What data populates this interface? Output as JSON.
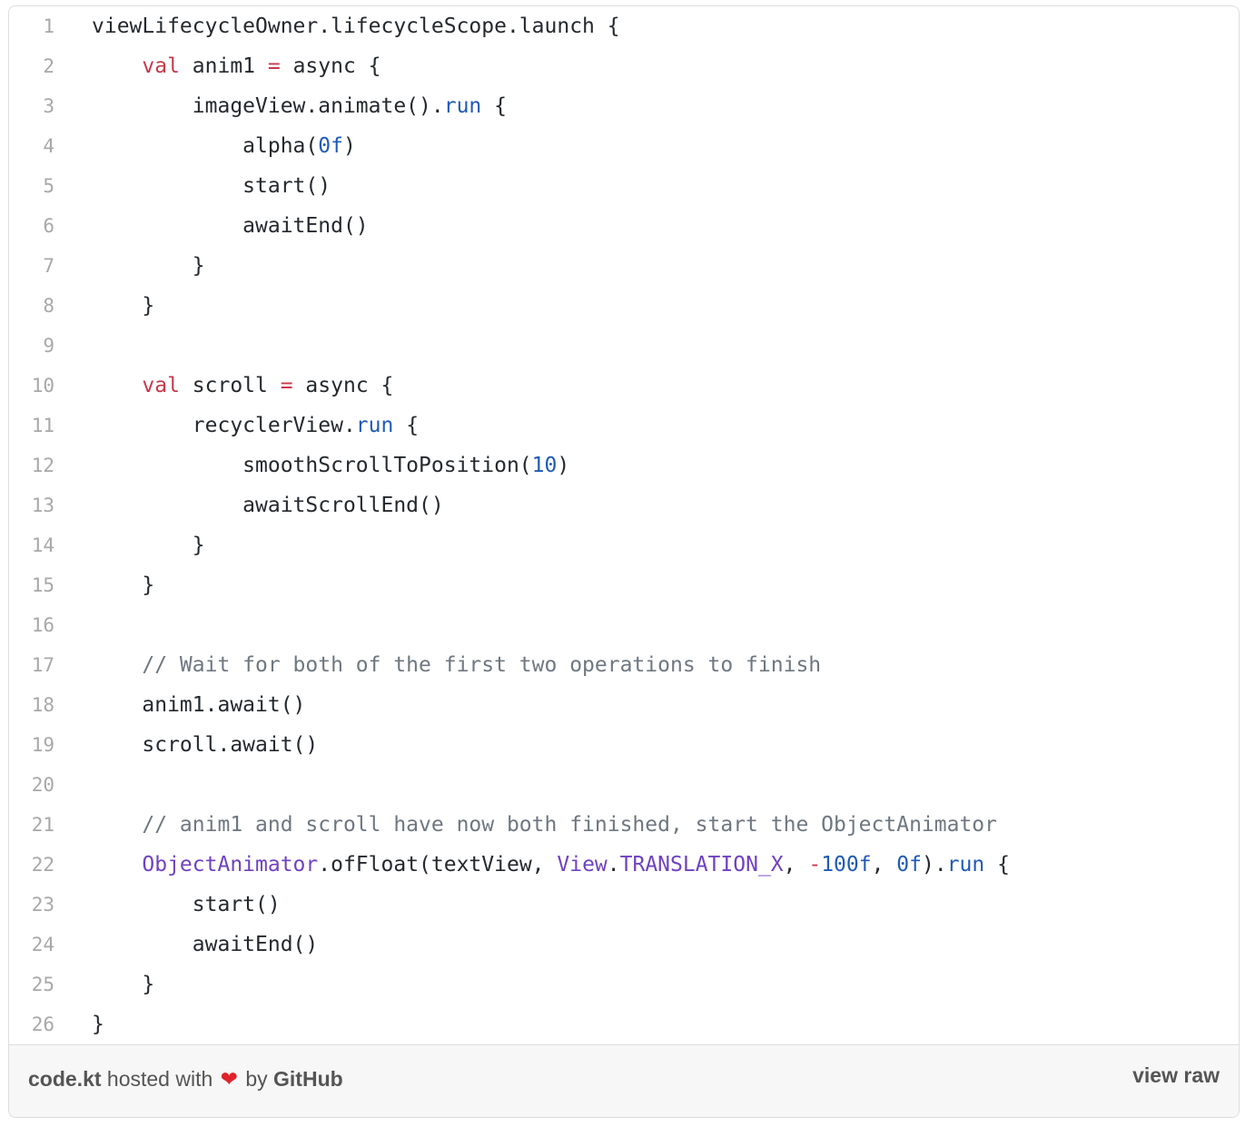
{
  "code": {
    "lines": [
      {
        "n": "1",
        "tokens": [
          {
            "t": "viewLifecycleOwner.lifecycleScope.launch {",
            "c": "fn"
          }
        ]
      },
      {
        "n": "2",
        "tokens": [
          {
            "t": "    ",
            "c": "fn"
          },
          {
            "t": "val",
            "c": "kw"
          },
          {
            "t": " anim1 ",
            "c": "fn"
          },
          {
            "t": "=",
            "c": "kw"
          },
          {
            "t": " async {",
            "c": "fn"
          }
        ]
      },
      {
        "n": "3",
        "tokens": [
          {
            "t": "        imageView.animate().",
            "c": "fn"
          },
          {
            "t": "run",
            "c": "bl"
          },
          {
            "t": " {",
            "c": "fn"
          }
        ]
      },
      {
        "n": "4",
        "tokens": [
          {
            "t": "            alpha(",
            "c": "fn"
          },
          {
            "t": "0f",
            "c": "bl"
          },
          {
            "t": ")",
            "c": "fn"
          }
        ]
      },
      {
        "n": "5",
        "tokens": [
          {
            "t": "            start()",
            "c": "fn"
          }
        ]
      },
      {
        "n": "6",
        "tokens": [
          {
            "t": "            awaitEnd()",
            "c": "fn"
          }
        ]
      },
      {
        "n": "7",
        "tokens": [
          {
            "t": "        }",
            "c": "fn"
          }
        ]
      },
      {
        "n": "8",
        "tokens": [
          {
            "t": "    }",
            "c": "fn"
          }
        ]
      },
      {
        "n": "9",
        "tokens": []
      },
      {
        "n": "10",
        "tokens": [
          {
            "t": "    ",
            "c": "fn"
          },
          {
            "t": "val",
            "c": "kw"
          },
          {
            "t": " scroll ",
            "c": "fn"
          },
          {
            "t": "=",
            "c": "kw"
          },
          {
            "t": " async {",
            "c": "fn"
          }
        ]
      },
      {
        "n": "11",
        "tokens": [
          {
            "t": "        recyclerView.",
            "c": "fn"
          },
          {
            "t": "run",
            "c": "bl"
          },
          {
            "t": " {",
            "c": "fn"
          }
        ]
      },
      {
        "n": "12",
        "tokens": [
          {
            "t": "            smoothScrollToPosition(",
            "c": "fn"
          },
          {
            "t": "10",
            "c": "bl"
          },
          {
            "t": ")",
            "c": "fn"
          }
        ]
      },
      {
        "n": "13",
        "tokens": [
          {
            "t": "            awaitScrollEnd()",
            "c": "fn"
          }
        ]
      },
      {
        "n": "14",
        "tokens": [
          {
            "t": "        }",
            "c": "fn"
          }
        ]
      },
      {
        "n": "15",
        "tokens": [
          {
            "t": "    }",
            "c": "fn"
          }
        ]
      },
      {
        "n": "16",
        "tokens": []
      },
      {
        "n": "17",
        "tokens": [
          {
            "t": "    // Wait for both of the first two operations to finish",
            "c": "cm"
          }
        ]
      },
      {
        "n": "18",
        "tokens": [
          {
            "t": "    anim1.await()",
            "c": "fn"
          }
        ]
      },
      {
        "n": "19",
        "tokens": [
          {
            "t": "    scroll.await()",
            "c": "fn"
          }
        ]
      },
      {
        "n": "20",
        "tokens": []
      },
      {
        "n": "21",
        "tokens": [
          {
            "t": "    // anim1 and scroll have now both finished, start the ObjectAnimator",
            "c": "cm"
          }
        ]
      },
      {
        "n": "22",
        "tokens": [
          {
            "t": "    ",
            "c": "fn"
          },
          {
            "t": "ObjectAnimator",
            "c": "pu"
          },
          {
            "t": ".ofFloat(textView, ",
            "c": "fn"
          },
          {
            "t": "View",
            "c": "pu"
          },
          {
            "t": ".",
            "c": "fn"
          },
          {
            "t": "TRANSLATION_X",
            "c": "pu"
          },
          {
            "t": ", ",
            "c": "fn"
          },
          {
            "t": "-",
            "c": "kw"
          },
          {
            "t": "100f",
            "c": "bl"
          },
          {
            "t": ", ",
            "c": "fn"
          },
          {
            "t": "0f",
            "c": "bl"
          },
          {
            "t": ").",
            "c": "fn"
          },
          {
            "t": "run",
            "c": "bl"
          },
          {
            "t": " {",
            "c": "fn"
          }
        ]
      },
      {
        "n": "23",
        "tokens": [
          {
            "t": "        start()",
            "c": "fn"
          }
        ]
      },
      {
        "n": "24",
        "tokens": [
          {
            "t": "        awaitEnd()",
            "c": "fn"
          }
        ]
      },
      {
        "n": "25",
        "tokens": [
          {
            "t": "    }",
            "c": "fn"
          }
        ]
      },
      {
        "n": "26",
        "tokens": [
          {
            "t": "}",
            "c": "fn"
          }
        ]
      }
    ]
  },
  "footer": {
    "filename": "code.kt",
    "hosted_text": "hosted with",
    "heart": "❤",
    "by_text": "by",
    "host": "GitHub",
    "view_raw": "view raw"
  },
  "colors": {
    "keyword": "#c8384a",
    "number": "#1f5ab8",
    "type": "#6f42c1",
    "comment": "#6e7781",
    "heart": "#e0222a"
  },
  "icons": [
    "heart-icon"
  ]
}
